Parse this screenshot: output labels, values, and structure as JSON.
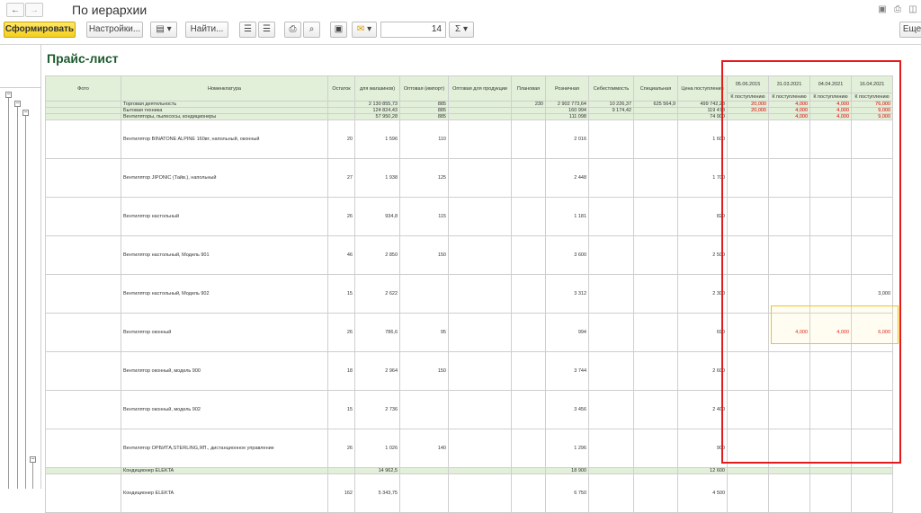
{
  "window": {
    "title": "По иерархии"
  },
  "toolbar": {
    "generate_label": "Сформировать",
    "settings_label": "Настройки...",
    "find_label": "Найти...",
    "number_value": "14",
    "sum_symbol": "Σ",
    "more_label": "Еще"
  },
  "report": {
    "title": "Прайс-лист",
    "columns": [
      "Фото",
      "Номенклатура",
      "Остаток",
      "для магазинов)",
      "Оптовая (импорт)",
      "Оптовая для продукции",
      "Плановая",
      "Розничная",
      "Себестоимость",
      "Специальная",
      "Цена поступления"
    ],
    "date_columns": [
      "05.06.2015",
      "31.03.2021",
      "04.04.2021",
      "16.04.2021"
    ],
    "date_subheader": "К поступлению",
    "rows": [
      {
        "type": "grp",
        "name": "Торговая деятельность",
        "stock": "",
        "shop": "2 130 855,73",
        "imp": "885",
        "prod": "",
        "plan": "230",
        "retail": "2 902 773,64",
        "cost": "10 226,37",
        "spec": "625 564,9",
        "arrival": "499 742,28",
        "d1": "20,000",
        "d2": "4,000",
        "d3": "4,000",
        "d4": "76,000"
      },
      {
        "type": "grp",
        "name": "Бытовая техника",
        "stock": "",
        "shop": "124 824,43",
        "imp": "885",
        "prod": "",
        "plan": "",
        "retail": "160 994",
        "cost": "9 174,42",
        "spec": "",
        "arrival": "119 478",
        "d1": "20,000",
        "d2": "4,000",
        "d3": "4,000",
        "d4": "9,000"
      },
      {
        "type": "grp",
        "name": "Вентиляторы, пылесосы, кондиционеры",
        "stock": "",
        "shop": "57 950,28",
        "imp": "885",
        "prod": "",
        "plan": "",
        "retail": "111 098",
        "cost": "",
        "spec": "",
        "arrival": "74 900",
        "d1": "",
        "d2": "4,000",
        "d3": "4,000",
        "d4": "9,000"
      },
      {
        "type": "item",
        "name": "Вентилятор BINATONE ALPINE 160вт, напольный, оконный",
        "stock": "20",
        "shop": "1 596",
        "imp": "110",
        "prod": "",
        "plan": "",
        "retail": "2 016",
        "cost": "",
        "spec": "",
        "arrival": "1 600",
        "d1": "",
        "d2": "",
        "d3": "",
        "d4": ""
      },
      {
        "type": "item",
        "name": "Вентилятор JIPONIC (Тайв.), напольный",
        "stock": "27",
        "shop": "1 938",
        "imp": "125",
        "prod": "",
        "plan": "",
        "retail": "2 448",
        "cost": "",
        "spec": "",
        "arrival": "1 700",
        "d1": "",
        "d2": "",
        "d3": "",
        "d4": ""
      },
      {
        "type": "item",
        "name": "Вентилятор настольный",
        "stock": "26",
        "shop": "934,8",
        "imp": "115",
        "prod": "",
        "plan": "",
        "retail": "1 181",
        "cost": "",
        "spec": "",
        "arrival": "820",
        "d1": "",
        "d2": "",
        "d3": "",
        "d4": ""
      },
      {
        "type": "item",
        "name": "Вентилятор настольный, Модель 901",
        "stock": "46",
        "shop": "2 850",
        "imp": "150",
        "prod": "",
        "plan": "",
        "retail": "3 600",
        "cost": "",
        "spec": "",
        "arrival": "2 500",
        "d1": "",
        "d2": "",
        "d3": "",
        "d4": ""
      },
      {
        "type": "item",
        "name": "Вентилятор настольный, Модель 902",
        "stock": "15",
        "shop": "2 622",
        "imp": "",
        "prod": "",
        "plan": "",
        "retail": "3 312",
        "cost": "",
        "spec": "",
        "arrival": "2 300",
        "d1": "",
        "d2": "",
        "d3": "",
        "d4": "3,000"
      },
      {
        "type": "item",
        "name": "Вентилятор оконный",
        "stock": "26",
        "shop": "786,6",
        "imp": "95",
        "prod": "",
        "plan": "",
        "retail": "994",
        "cost": "",
        "spec": "",
        "arrival": "690",
        "d1": "",
        "d2": "4,000",
        "d3": "4,000",
        "d4": "6,000"
      },
      {
        "type": "item",
        "name": "Вентилятор оконный, модель 900",
        "stock": "18",
        "shop": "2 964",
        "imp": "150",
        "prod": "",
        "plan": "",
        "retail": "3 744",
        "cost": "",
        "spec": "",
        "arrival": "2 600",
        "d1": "",
        "d2": "",
        "d3": "",
        "d4": ""
      },
      {
        "type": "item",
        "name": "Вентилятор оконный, модель 902",
        "stock": "15",
        "shop": "2 736",
        "imp": "",
        "prod": "",
        "plan": "",
        "retail": "3 456",
        "cost": "",
        "spec": "",
        "arrival": "2 400",
        "d1": "",
        "d2": "",
        "d3": "",
        "d4": ""
      },
      {
        "type": "item",
        "name": "Вентилятор ОРБИТА,STERLING,ЯП., дистанционное управление",
        "stock": "26",
        "shop": "1 026",
        "imp": "140",
        "prod": "",
        "plan": "",
        "retail": "1 296",
        "cost": "",
        "spec": "",
        "arrival": "900",
        "d1": "",
        "d2": "",
        "d3": "",
        "d4": ""
      },
      {
        "type": "sub",
        "name": "Кондиционер ELEKTA",
        "stock": "",
        "shop": "14 962,5",
        "imp": "",
        "prod": "",
        "plan": "",
        "retail": "18 900",
        "cost": "",
        "spec": "",
        "arrival": "12 600",
        "d1": "",
        "d2": "",
        "d3": "",
        "d4": ""
      },
      {
        "type": "item",
        "name": "Кондиционер ELEKTA",
        "stock": "162",
        "shop": "5 343,75",
        "imp": "",
        "prod": "",
        "plan": "",
        "retail": "6 750",
        "cost": "",
        "spec": "",
        "arrival": "4 500",
        "d1": "",
        "d2": "",
        "d3": "",
        "d4": ""
      }
    ]
  }
}
